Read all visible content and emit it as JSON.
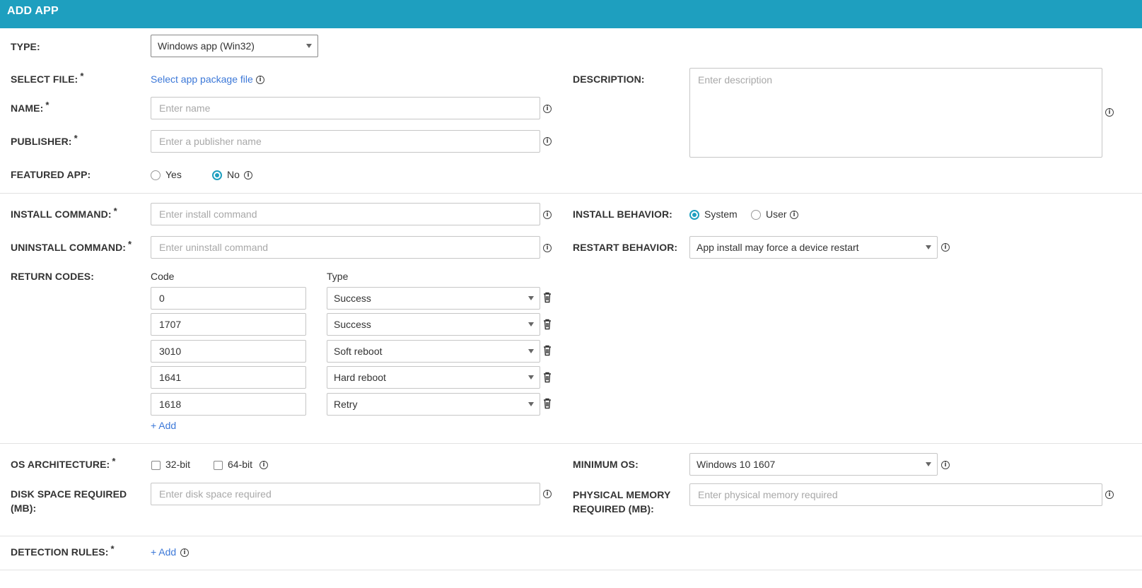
{
  "header": {
    "title": "ADD APP"
  },
  "type": {
    "label": "TYPE:",
    "value": "Windows app (Win32)"
  },
  "select_file": {
    "label": "SELECT FILE:",
    "required": "*",
    "link": "Select app package file"
  },
  "name": {
    "label": "NAME:",
    "required": "*",
    "placeholder": "Enter name"
  },
  "publisher": {
    "label": "PUBLISHER:",
    "required": "*",
    "placeholder": "Enter a publisher name"
  },
  "featured": {
    "label": "FEATURED APP:",
    "options": [
      "Yes",
      "No"
    ],
    "selected": "No"
  },
  "description": {
    "label": "DESCRIPTION:",
    "placeholder": "Enter description"
  },
  "install_command": {
    "label": "INSTALL COMMAND:",
    "required": "*",
    "placeholder": "Enter install command"
  },
  "uninstall_command": {
    "label": "UNINSTALL COMMAND:",
    "required": "*",
    "placeholder": "Enter uninstall command"
  },
  "install_behavior": {
    "label": "INSTALL BEHAVIOR:",
    "options": [
      "System",
      "User"
    ],
    "selected": "System"
  },
  "restart_behavior": {
    "label": "RESTART BEHAVIOR:",
    "value": "App install may force a device restart"
  },
  "return_codes": {
    "label": "RETURN CODES:",
    "col_code": "Code",
    "col_type": "Type",
    "rows": [
      {
        "code": "0",
        "type": "Success"
      },
      {
        "code": "1707",
        "type": "Success"
      },
      {
        "code": "3010",
        "type": "Soft reboot"
      },
      {
        "code": "1641",
        "type": "Hard reboot"
      },
      {
        "code": "1618",
        "type": "Retry"
      }
    ],
    "add_label": "+ Add"
  },
  "os_architecture": {
    "label": "OS ARCHITECTURE:",
    "required": "*",
    "options": [
      "32-bit",
      "64-bit"
    ]
  },
  "minimum_os": {
    "label": "MINIMUM OS:",
    "value": "Windows 10 1607"
  },
  "disk_space": {
    "label_line1": "DISK SPACE REQUIRED",
    "label_line2": "(MB):",
    "placeholder": "Enter disk space required"
  },
  "physical_memory": {
    "label_line1": "PHYSICAL MEMORY",
    "label_line2": "REQUIRED (MB):",
    "placeholder": "Enter physical memory required"
  },
  "detection_rules": {
    "label": "DETECTION RULES:",
    "required": "*",
    "add_label": "+ Add"
  },
  "icons": {
    "info": "info-icon",
    "trash": "trash-icon",
    "caret": "caret-down-icon"
  },
  "colors": {
    "accent": "#1e9fbf",
    "link": "#3c78d8"
  }
}
